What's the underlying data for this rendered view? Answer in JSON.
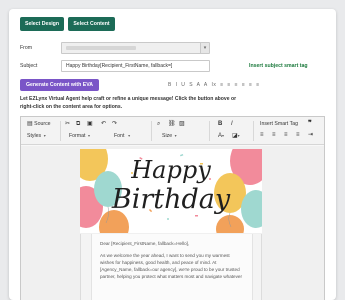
{
  "actions": {
    "select_design": "Select Design",
    "select_content": "Select Content"
  },
  "form": {
    "from_label": "From",
    "subject_label": "Subject",
    "subject_value": "Happy Birthday[Recipient_FirstName, fallback=]",
    "insert_smart_tag_link": "Insert subject smart tag"
  },
  "eva": {
    "button_label": "Generate Content with EVA",
    "line1": "Let EZLynx Virtual Agent help craft or refine a unique message! Click the button above or",
    "line2": "right-click on the content area for options."
  },
  "mini_toolbar": {
    "items": [
      "B",
      "I",
      "U",
      "S",
      "A",
      "A",
      "Ix",
      "≡",
      "≡",
      "≡",
      "≡",
      "≡",
      "≡"
    ]
  },
  "toolbar": {
    "source": "Source",
    "styles": "Styles",
    "format": "Format",
    "font": "Font",
    "size": "Size",
    "insert_smart_tag": "Insert Smart Tag",
    "quote": "❞"
  },
  "banner": {
    "line1": "Happy",
    "line2": "Birthday"
  },
  "letter": {
    "greeting": "Dear [Recipient_FirstName, fallback=Hello],",
    "body": [
      "As we welcome the year ahead, I want to send you my warmest",
      "wishes for happiness, good health, and peace of mind. At",
      "[Agency_Name, fallback=our agency], we're proud to be your trusted",
      "partner, helping you protect what matters most and navigate whatever"
    ]
  },
  "colors": {
    "primary_green": "#1c6b57",
    "link_green": "#1c7a3d",
    "eva_purple": "#7a55c7"
  }
}
